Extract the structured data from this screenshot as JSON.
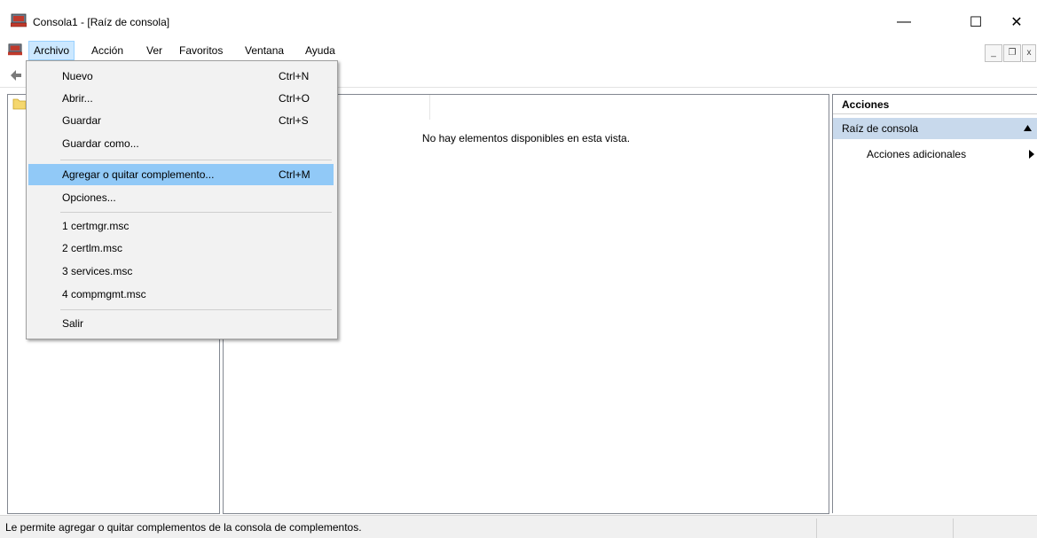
{
  "window": {
    "title": "Consola1 - [Raíz de consola]",
    "controls": {
      "minimize": "—",
      "maximize": "☐",
      "close": "✕"
    }
  },
  "menubar": {
    "items": [
      "Archivo",
      "Acción",
      "Ver",
      "Favoritos",
      "Ventana",
      "Ayuda"
    ],
    "mdi": {
      "minimize": "_",
      "restore": "❐",
      "close": "x"
    }
  },
  "dropdown": {
    "items": [
      {
        "label": "Nuevo",
        "shortcut": "Ctrl+N"
      },
      {
        "label": "Abrir...",
        "shortcut": "Ctrl+O"
      },
      {
        "label": "Guardar",
        "shortcut": "Ctrl+S"
      },
      {
        "label": "Guardar como...",
        "shortcut": ""
      },
      {
        "label": "Agregar o quitar complemento...",
        "shortcut": "Ctrl+M"
      },
      {
        "label": "Opciones...",
        "shortcut": ""
      },
      {
        "label": "1 certmgr.msc",
        "shortcut": ""
      },
      {
        "label": "2 certlm.msc",
        "shortcut": ""
      },
      {
        "label": "3 services.msc",
        "shortcut": ""
      },
      {
        "label": "4 compmgmt.msc",
        "shortcut": ""
      },
      {
        "label": "Salir",
        "shortcut": ""
      }
    ]
  },
  "results": {
    "empty_message": "No hay elementos disponibles en esta vista."
  },
  "actions": {
    "header": "Acciones",
    "section": "Raíz de consola",
    "items": [
      "Acciones adicionales"
    ]
  },
  "statusbar": {
    "text": "Le permite agregar o quitar complementos de la consola de complementos."
  },
  "colors": {
    "highlight": "#91c9f7",
    "menu_active": "#cce8ff",
    "section_bg": "#c8d9ec",
    "menu_bg": "#f2f2f2"
  }
}
